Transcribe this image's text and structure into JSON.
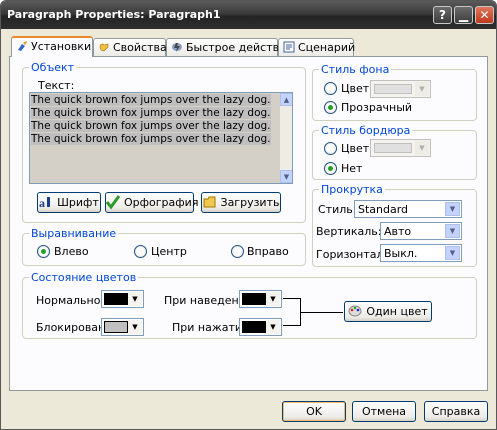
{
  "window": {
    "title": "Paragraph Properties: Paragraph1"
  },
  "tabs": [
    {
      "label": "Установки",
      "icon": "brush-icon"
    },
    {
      "label": "Свойства",
      "icon": "hand-icon"
    },
    {
      "label": "Быстрое действие",
      "icon": "lightning-icon"
    },
    {
      "label": "Сценарий",
      "icon": "script-icon"
    }
  ],
  "object": {
    "legend": "Объект",
    "text_label": "Текст:",
    "text_value": "The quick brown fox jumps over the lazy dog. The quick brown fox jumps over the lazy dog. The quick brown fox jumps over the lazy dog. The quick brown fox jumps over the lazy dog.",
    "buttons": {
      "font": "Шрифт",
      "spelling": "Орфография",
      "load": "Загрузить"
    }
  },
  "alignment": {
    "legend": "Выравнивание",
    "options": [
      "Влево",
      "Центр",
      "Вправо"
    ],
    "selected": "Влево"
  },
  "colors": {
    "legend": "Состояние цветов",
    "normal": "Нормальное:",
    "hover": "При наведение:",
    "disabled": "Блокировано",
    "pressed": "При нажатии:",
    "one_color_button": "Один цвет",
    "swatch_black": "#000000",
    "swatch_gray": "#c0c0c0"
  },
  "bg_style": {
    "legend": "Стиль фона",
    "color": "Цвет",
    "transparent": "Прозрачный",
    "selected": "Прозрачный"
  },
  "border_style": {
    "legend": "Стиль бордюра",
    "color": "Цвет",
    "none": "Нет",
    "selected": "Нет"
  },
  "scroll": {
    "legend": "Прокрутка",
    "style_label": "Стиль:",
    "style_value": "Standard",
    "vertical_label": "Вертикаль:",
    "vertical_value": "Авто",
    "horizontal_label": "Горизонталь:",
    "horizontal_value": "Выкл."
  },
  "footer": {
    "ok": "OK",
    "cancel": "Отмена",
    "help": "Справка"
  }
}
